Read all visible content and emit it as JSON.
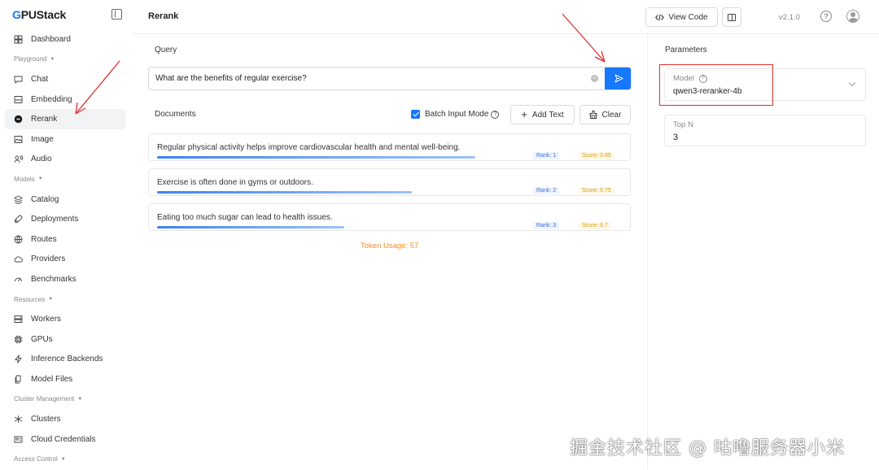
{
  "brand": {
    "prefix": "G",
    "rest": "PUStack"
  },
  "sidebar": {
    "items": [
      {
        "type": "item",
        "label": "Dashboard",
        "icon": "dashboard-icon"
      },
      {
        "type": "group",
        "label": "Playground"
      },
      {
        "type": "item",
        "label": "Chat",
        "icon": "chat-icon"
      },
      {
        "type": "item",
        "label": "Embedding",
        "icon": "embedding-icon"
      },
      {
        "type": "item",
        "label": "Rerank",
        "icon": "rerank-icon",
        "active": true
      },
      {
        "type": "item",
        "label": "Image",
        "icon": "image-icon"
      },
      {
        "type": "item",
        "label": "Audio",
        "icon": "audio-icon"
      },
      {
        "type": "group",
        "label": "Models"
      },
      {
        "type": "item",
        "label": "Catalog",
        "icon": "catalog-icon"
      },
      {
        "type": "item",
        "label": "Deployments",
        "icon": "rocket-icon"
      },
      {
        "type": "item",
        "label": "Routes",
        "icon": "globe-icon"
      },
      {
        "type": "item",
        "label": "Providers",
        "icon": "cloud-icon"
      },
      {
        "type": "item",
        "label": "Benchmarks",
        "icon": "gauge-icon"
      },
      {
        "type": "group",
        "label": "Resources"
      },
      {
        "type": "item",
        "label": "Workers",
        "icon": "server-icon"
      },
      {
        "type": "item",
        "label": "GPUs",
        "icon": "chip-icon"
      },
      {
        "type": "item",
        "label": "Inference Backends",
        "icon": "bolt-icon"
      },
      {
        "type": "item",
        "label": "Model Files",
        "icon": "files-icon"
      },
      {
        "type": "group",
        "label": "Cluster Management"
      },
      {
        "type": "item",
        "label": "Clusters",
        "icon": "cluster-icon"
      },
      {
        "type": "item",
        "label": "Cloud Credentials",
        "icon": "credential-icon"
      },
      {
        "type": "group",
        "label": "Access Control"
      }
    ]
  },
  "header": {
    "title": "Rerank",
    "view_code_label": "View Code",
    "version": "v2.1.0"
  },
  "query": {
    "label": "Query",
    "value": "What are the benefits of regular exercise?"
  },
  "documents": {
    "label": "Documents",
    "batch_label": "Batch Input Mode",
    "batch_checked": true,
    "add_text_label": "Add Text",
    "clear_label": "Clear",
    "items": [
      {
        "text": "Regular physical activity helps improve cardiovascular health and mental well-being.",
        "rank": "Rank: 1",
        "score": "Score: 0.85",
        "score_value": 0.85
      },
      {
        "text": "Exercise is often done in gyms or outdoors.",
        "rank": "Rank: 2",
        "score": "Score: 0.75",
        "score_value": 0.68
      },
      {
        "text": "Eating too much sugar can lead to health issues.",
        "rank": "Rank: 3",
        "score": "Score: 0.7",
        "score_value": 0.5
      }
    ]
  },
  "token_usage": "Token Usage: 57",
  "parameters": {
    "label": "Parameters",
    "model_label": "Model",
    "model_value": "qwen3-reranker-4b",
    "topn_label": "Top N",
    "topn_value": "3"
  },
  "watermark": "掘金技术社区 @ 咕噜服务器小米",
  "colors": {
    "accent": "#1677ff",
    "annotation": "#e03131",
    "token": "#fa8c16"
  }
}
